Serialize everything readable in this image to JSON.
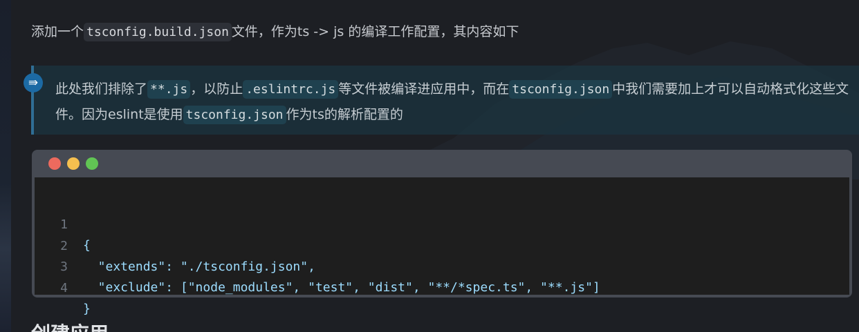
{
  "paragraph": {
    "prefix": "添加一个",
    "code": "tsconfig.build.json",
    "suffix": "文件，作为ts -> js 的编译工作配置，其内容如下"
  },
  "tip": {
    "icon": "double-arrow-icon",
    "icon_glyph": "⇛",
    "t1": "此处我们排除了",
    "c1": "**.js",
    "t2": "，以防止",
    "c2": ".eslintrc.js",
    "t3": "等文件被编译进应用中，而在",
    "c3": "tsconfig.json",
    "t4": "中我们需要加上才可以自动格式化这些文件。因为eslint是使用",
    "c4": "tsconfig.json",
    "t5": "作为ts的解析配置的"
  },
  "code_block": {
    "window_dots": [
      "#ed6a5e",
      "#f5bf4f",
      "#61c554"
    ],
    "lines": [
      {
        "num": "1",
        "text": "{"
      },
      {
        "num": "2",
        "text": "  \"extends\": \"./tsconfig.json\","
      },
      {
        "num": "3",
        "text": "  \"exclude\": [\"node_modules\", \"test\", \"dist\", \"**/*spec.ts\", \"**.js\"]"
      },
      {
        "num": "4",
        "text": "}"
      }
    ]
  },
  "heading": "创建应用"
}
